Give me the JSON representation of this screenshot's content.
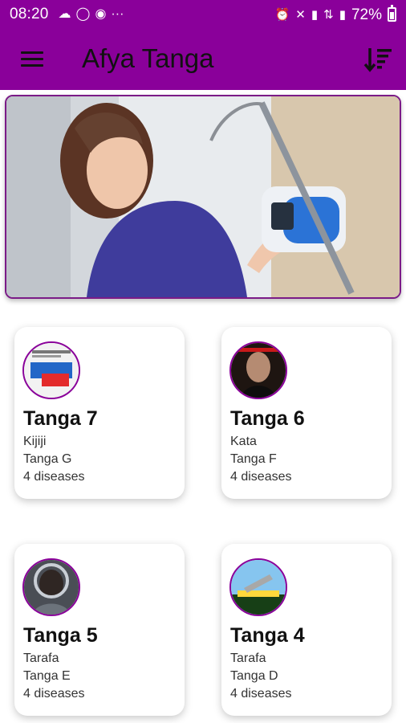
{
  "status_bar": {
    "time": "08:20",
    "battery_text": "72%",
    "left_icons": [
      "cloud-icon",
      "whatsapp-icon",
      "chrome-icon",
      "more-dots-icon"
    ],
    "right_icons": [
      "alarm-icon",
      "mute-icon",
      "signal-icon",
      "data-icon",
      "signal-icon",
      "battery-icon"
    ]
  },
  "app_bar": {
    "title": "Afya Tanga",
    "menu_icon": "menu-icon",
    "sort_icon": "sort-descending-icon",
    "color": "#8a009a"
  },
  "banner": {
    "description_icon": "nurse-iv-pump-photo"
  },
  "cards": [
    {
      "title": "Tanga 7",
      "line1": "Kijiji",
      "line2": "Tanga G",
      "line3": "4 diseases"
    },
    {
      "title": "Tanga 6",
      "line1": "Kata",
      "line2": "Tanga F",
      "line3": "4 diseases"
    },
    {
      "title": "Tanga 5",
      "line1": "Tarafa",
      "line2": "Tanga E",
      "line3": "4 diseases"
    },
    {
      "title": "Tanga 4",
      "line1": "Tarafa",
      "line2": "Tanga D",
      "line3": "4 diseases"
    }
  ]
}
